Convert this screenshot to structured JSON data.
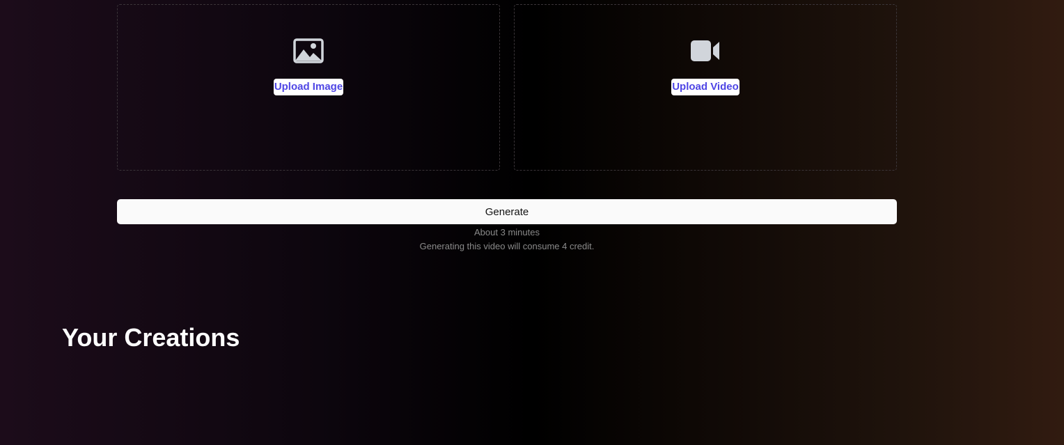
{
  "upload": {
    "image": {
      "label": "Upload Image",
      "icon": "image-icon"
    },
    "video": {
      "label": "Upload Video",
      "icon": "video-camera-icon"
    }
  },
  "generate": {
    "button_label": "Generate",
    "eta": "About 3 minutes",
    "credit_notice": "Generating this video will consume 4 credit."
  },
  "creations": {
    "title": "Your Creations"
  },
  "colors": {
    "link": "#4f46e5",
    "icon": "#d1d5db",
    "button_bg": "#fafafa",
    "muted_text": "#8a8a8a"
  }
}
